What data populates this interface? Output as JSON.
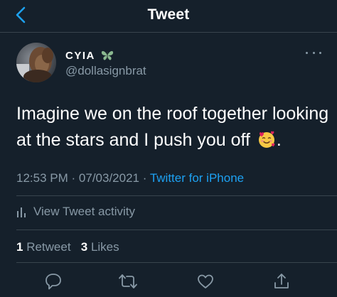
{
  "header": {
    "title": "Tweet",
    "back_icon": "chevron-left-icon"
  },
  "author": {
    "display_name": "CYIA",
    "name_badge_icon": "butterfly-icon",
    "handle": "@dollasignbrat",
    "more_icon": "more-dots-icon"
  },
  "tweet": {
    "text": "Imagine we on the roof together looking at the stars and I push you off",
    "emoji": "smiling-face-with-hearts-emoji",
    "text_end": ".",
    "time": "12:53 PM",
    "date": "07/03/2021",
    "separator": "·",
    "source": "Twitter for iPhone"
  },
  "activity": {
    "label": "View Tweet activity",
    "icon": "bar-chart-icon"
  },
  "stats": {
    "retweets_count": "1",
    "retweets_label": "Retweet",
    "likes_count": "3",
    "likes_label": "Likes"
  },
  "actions": [
    "reply-icon",
    "retweet-icon",
    "like-icon",
    "share-icon"
  ],
  "colors": {
    "background": "#15202b",
    "divider": "#38444d",
    "secondary_text": "#8899a6",
    "accent": "#1da1f2",
    "badge": "#8ab890"
  }
}
